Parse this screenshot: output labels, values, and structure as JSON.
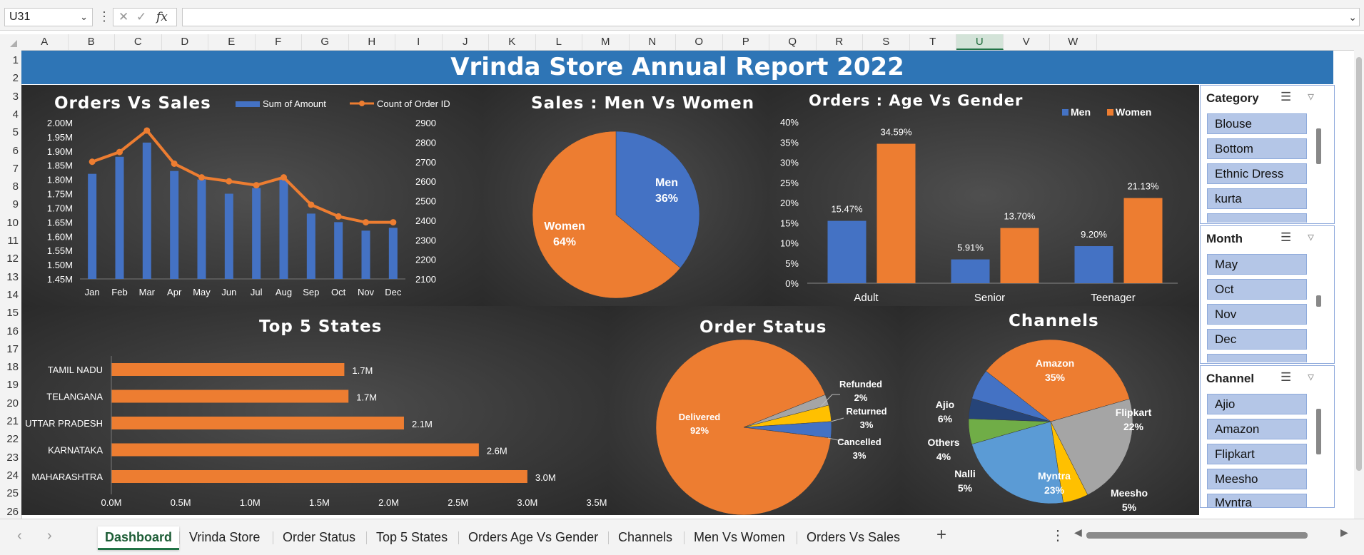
{
  "formula_bar": {
    "name_box": "U31",
    "formula": ""
  },
  "columns": [
    "A",
    "B",
    "C",
    "D",
    "E",
    "F",
    "G",
    "H",
    "I",
    "J",
    "K",
    "L",
    "M",
    "N",
    "O",
    "P",
    "Q",
    "R",
    "S",
    "T",
    "U",
    "V",
    "W"
  ],
  "selected_column": "U",
  "rows": [
    "1",
    "2",
    "3",
    "4",
    "5",
    "6",
    "7",
    "8",
    "9",
    "10",
    "11",
    "12",
    "13",
    "14",
    "15",
    "16",
    "17",
    "18",
    "19",
    "20",
    "21",
    "22",
    "23",
    "24",
    "25",
    "26"
  ],
  "report": {
    "title": "Vrinda Store Annual Report 2022"
  },
  "chart_data": [
    {
      "type": "bar+line",
      "title": "Orders Vs Sales",
      "categories": [
        "Jan",
        "Feb",
        "Mar",
        "Apr",
        "May",
        "Jun",
        "Jul",
        "Aug",
        "Sep",
        "Oct",
        "Nov",
        "Dec"
      ],
      "series": [
        {
          "name": "Sum of Amount",
          "type": "bar",
          "axis": "left",
          "values": [
            1.82,
            1.88,
            1.93,
            1.83,
            1.8,
            1.75,
            1.77,
            1.8,
            1.68,
            1.65,
            1.62,
            1.63
          ]
        },
        {
          "name": "Count of Order ID",
          "type": "line",
          "axis": "right",
          "values": [
            2700,
            2750,
            2860,
            2690,
            2620,
            2600,
            2580,
            2620,
            2480,
            2420,
            2390,
            2390
          ]
        }
      ],
      "y_left_ticks": [
        "1.45M",
        "1.50M",
        "1.55M",
        "1.60M",
        "1.65M",
        "1.70M",
        "1.75M",
        "1.80M",
        "1.85M",
        "1.90M",
        "1.95M",
        "2.00M"
      ],
      "y_left_range": [
        1.45,
        2.0
      ],
      "y_right_ticks": [
        "2100",
        "2200",
        "2300",
        "2400",
        "2500",
        "2600",
        "2700",
        "2800",
        "2900"
      ],
      "y_right_range": [
        2100,
        2900
      ],
      "legend": "top"
    },
    {
      "type": "pie",
      "title": "Sales : Men Vs Women",
      "slices": [
        {
          "name": "Men",
          "label": "36%",
          "value": 36,
          "color": "#4472c4"
        },
        {
          "name": "Women",
          "label": "64%",
          "value": 64,
          "color": "#ed7d31"
        }
      ]
    },
    {
      "type": "bar",
      "title": "Orders : Age Vs Gender",
      "categories": [
        "Adult",
        "Senior",
        "Teenager"
      ],
      "series": [
        {
          "name": "Men",
          "values": [
            15.47,
            5.91,
            9.2
          ],
          "labels": [
            "15.47%",
            "5.91%",
            "9.20%"
          ],
          "color": "#4472c4"
        },
        {
          "name": "Women",
          "values": [
            34.59,
            13.7,
            21.13
          ],
          "labels": [
            "34.59%",
            "13.70%",
            "21.13%"
          ],
          "color": "#ed7d31"
        }
      ],
      "y_ticks": [
        "0%",
        "5%",
        "10%",
        "15%",
        "20%",
        "25%",
        "30%",
        "35%",
        "40%"
      ],
      "ylim": [
        0,
        40
      ],
      "legend": "top-right"
    },
    {
      "type": "bar",
      "orientation": "horizontal",
      "title": "Top 5 States",
      "categories": [
        "TAMIL NADU",
        "TELANGANA",
        "UTTAR PRADESH",
        "KARNATAKA",
        "MAHARASHTRA"
      ],
      "values": [
        1.7,
        1.7,
        2.1,
        2.6,
        3.0
      ],
      "display_values": [
        1.68,
        1.71,
        2.11,
        2.65,
        3.0
      ],
      "labels": [
        "1.7M",
        "1.7M",
        "2.1M",
        "2.6M",
        "3.0M"
      ],
      "x_ticks": [
        "0.0M",
        "0.5M",
        "1.0M",
        "1.5M",
        "2.0M",
        "2.5M",
        "3.0M",
        "3.5M"
      ],
      "xlim": [
        0,
        3.5
      ],
      "color": "#ed7d31"
    },
    {
      "type": "pie",
      "title": "Order Status",
      "slices": [
        {
          "name": "Delivered",
          "label": "92%",
          "value": 92,
          "color": "#ed7d31"
        },
        {
          "name": "Refunded",
          "label": "2%",
          "value": 2,
          "color": "#a5a5a5"
        },
        {
          "name": "Returned",
          "label": "3%",
          "value": 3,
          "color": "#ffc000"
        },
        {
          "name": "Cancelled",
          "label": "3%",
          "value": 3,
          "color": "#4472c4"
        }
      ]
    },
    {
      "type": "pie",
      "title": "Channels",
      "slices": [
        {
          "name": "Amazon",
          "label": "35%",
          "value": 35,
          "color": "#ed7d31"
        },
        {
          "name": "Flipkart",
          "label": "22%",
          "value": 22,
          "color": "#a5a5a5"
        },
        {
          "name": "Meesho",
          "label": "5%",
          "value": 5,
          "color": "#ffc000"
        },
        {
          "name": "Myntra",
          "label": "23%",
          "value": 23,
          "color": "#5b9bd5"
        },
        {
          "name": "Nalli",
          "label": "5%",
          "value": 5,
          "color": "#70ad47"
        },
        {
          "name": "Others",
          "label": "4%",
          "value": 4,
          "color": "#264478"
        },
        {
          "name": "Ajio",
          "label": "6%",
          "value": 6,
          "color": "#4472c4"
        }
      ]
    }
  ],
  "slicers": {
    "category": {
      "title": "Category",
      "items": [
        "Blouse",
        "Bottom",
        "Ethnic Dress",
        "kurta"
      ]
    },
    "month": {
      "title": "Month",
      "items": [
        "May",
        "Oct",
        "Nov",
        "Dec"
      ]
    },
    "channel": {
      "title": "Channel",
      "items": [
        "Ajio",
        "Amazon",
        "Flipkart",
        "Meesho",
        "Myntra"
      ]
    }
  },
  "sheet_tabs": [
    "Dashboard",
    "Vrinda Store",
    "Order Status",
    "Top 5 States",
    "Orders  Age Vs Gender",
    "Channels",
    "Men Vs Women",
    "Orders Vs Sales"
  ],
  "active_tab": "Dashboard",
  "colors": {
    "banner": "#2e75b6",
    "accent_green": "#217346",
    "orange": "#ed7d31",
    "blue": "#4472c4"
  }
}
